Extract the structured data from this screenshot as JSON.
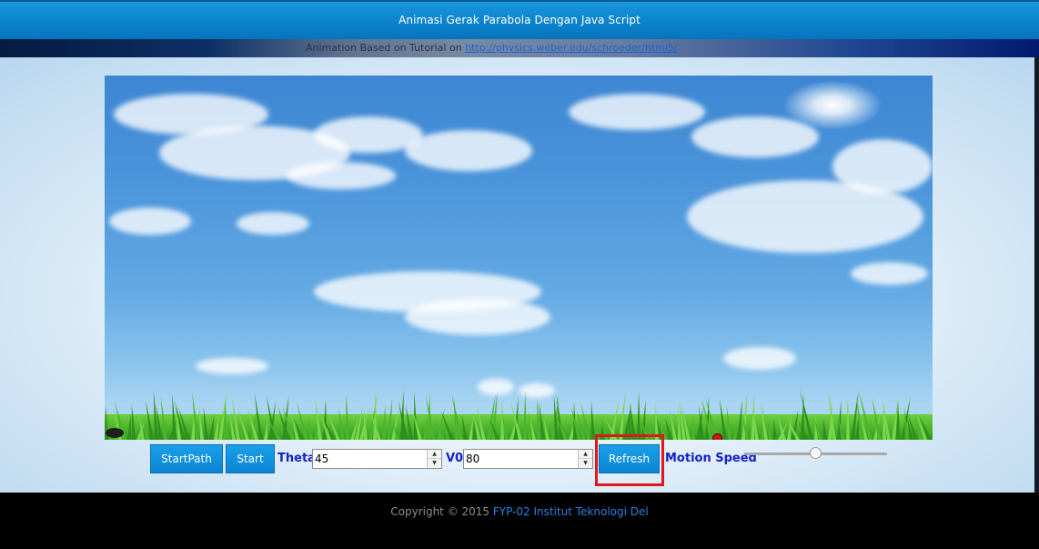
{
  "header": {
    "title": "Animasi Gerak Parabola Dengan Java Script",
    "subtitle_prefix": "Animation Based on Tutorial on",
    "subtitle_link": "http://physics.weber.edu/schroeder/html5/"
  },
  "controls": {
    "start_path_label": "StartPath",
    "start_label": "Start",
    "theta_label": "Theta",
    "theta_value": "45",
    "v0_label": "V0",
    "v0_value": "80",
    "refresh_label": "Refresh",
    "motion_speed_label": "Motion Speed",
    "motion_speed_fraction": 0.5
  },
  "footer": {
    "copyright": "Copyright © 2015",
    "org": "FYP-02 Institut Teknologi Del"
  },
  "colors": {
    "header_blue": "#0a83cc",
    "button_blue": "#0b84d2",
    "label_blue": "#1420c8",
    "highlight_red": "#e0181d",
    "footer_link": "#2f7fe0"
  }
}
